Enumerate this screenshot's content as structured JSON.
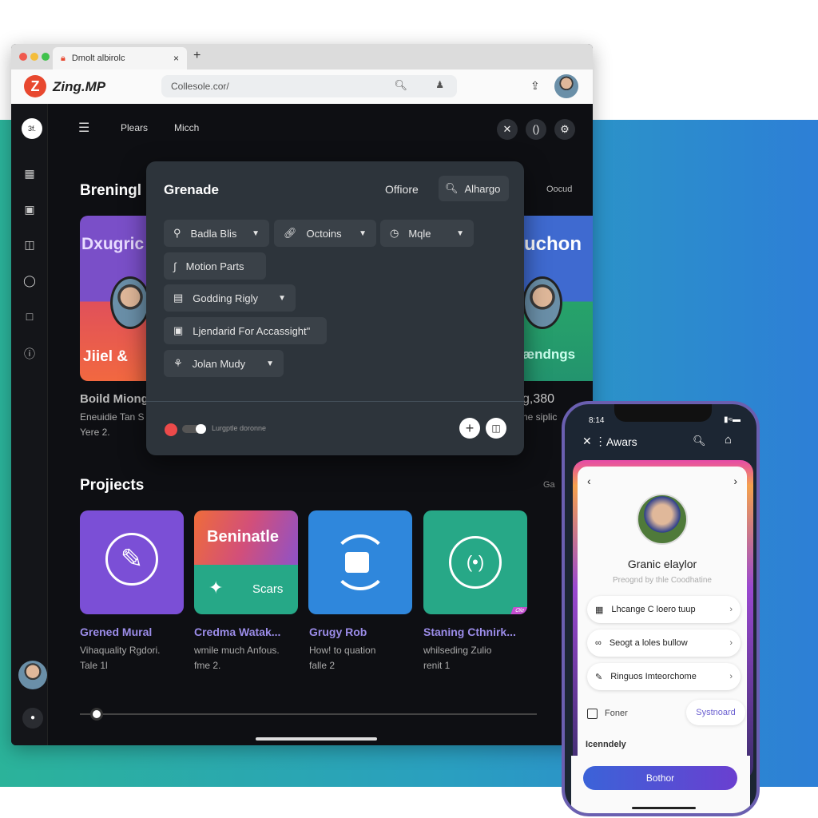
{
  "browser": {
    "tab_title": "Dmolt albirolc",
    "tab_close": "×",
    "new_tab": "+",
    "brand_logo": "Z",
    "brand": "Zing.MP",
    "url": "Collesole.cor/",
    "colors": {
      "accent": "#e8482f"
    }
  },
  "app": {
    "sidebar_badge": "3f.",
    "nav": [
      "Plears",
      "Micch"
    ],
    "sidebar_icons": [
      "grid-icon",
      "calendar-icon",
      "box-icon",
      "chat-icon",
      "square-icon",
      "info-icon"
    ],
    "section1": {
      "title": "Breningl",
      "right_label": "Oocud",
      "card_left": {
        "top": "Dxugric",
        "bottom": "Jiiel &",
        "title": "Boild Miong",
        "sub1": "Eneuidie Tan S",
        "sub2": "Yere 2."
      },
      "card_right": {
        "top": "uchon",
        "bottom": "ændngs",
        "title": "g,380",
        "sub1": "he siplic"
      }
    },
    "section2": {
      "title": "Projiects",
      "right_label": "Ga",
      "projects": [
        {
          "title": "Grened Mural",
          "desc": "Vihaquality Rgdori.",
          "meta": "Tale 1l",
          "color": "#7b4fd6"
        },
        {
          "title": "Credma Watak...",
          "desc": "wmile much Anfous.",
          "meta": "fme 2.",
          "banner": "Beninatle",
          "label": "Scars"
        },
        {
          "title": "Grugy Rob",
          "desc": "How! to quation",
          "meta": "falle 2",
          "color": "#2f87dc"
        },
        {
          "title": "Staning Cthnirk...",
          "desc": "whilseding Zulio",
          "meta": "renit 1",
          "color": "#27a887",
          "badge": "Ole"
        }
      ]
    },
    "progress": 0.02
  },
  "modal": {
    "title": "Grenade",
    "link": "Offiore",
    "search": "Alhargo",
    "chips": [
      {
        "label": "Badla Blis",
        "dropdown": true
      },
      {
        "label": "Octoins",
        "dropdown": true
      },
      {
        "label": "Mqle",
        "dropdown": true
      },
      {
        "label": "Motion Parts",
        "dropdown": false
      },
      {
        "label": "Godding Rigly",
        "dropdown": true
      },
      {
        "label": "Ljendarid For Accassight\"",
        "dropdown": false
      },
      {
        "label": "Jolan Mudy",
        "dropdown": true
      }
    ],
    "footer_text": "Lurgptle doronne",
    "toggle_on": true
  },
  "phone": {
    "time": "8:14",
    "title": "Awars",
    "name": "Granic elaylor",
    "subtitle": "Preognd by thle Coodhatine",
    "rows": [
      "Lhcange C loero tuup",
      "Seogt a loles bullow",
      "Ringuos Imteorchome"
    ],
    "checkbox_label": "Foner",
    "checkbox_checked": false,
    "chip": "Systnoard",
    "section": "Icenndely",
    "button": "Bothor"
  }
}
